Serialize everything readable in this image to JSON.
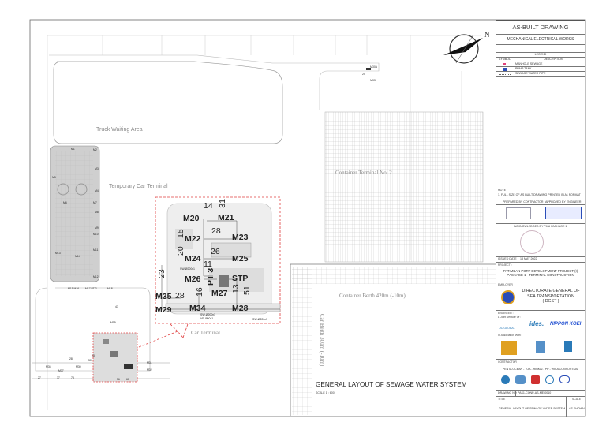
{
  "drawing": {
    "areas": {
      "truck_waiting": "Truck Waiting Area",
      "temp_car_terminal": "Temporary Car Terminal",
      "container_terminal": "Container Terminal No. 2",
      "car_terminal": "Car Terminal",
      "container_berth": "Container Berth 420m (-10m)",
      "car_berth": "Car Berth 300m (-10m)"
    },
    "title": "GENERAL LAYOUT  OF SEWAGE WATER SYSTEM",
    "scale": "SCALE 1 : 600",
    "north": "N",
    "top_labels": [
      "M30A",
      "M33",
      "25"
    ],
    "detail_labels": [
      "M20",
      "M21",
      "14",
      "31",
      "28",
      "15",
      "M22",
      "M23",
      "20",
      "26",
      "M24",
      "M25",
      "SW-Ø200x1",
      "23",
      "11",
      "M26",
      "PT 3",
      "STP",
      "16",
      "M27",
      "13",
      "51",
      "M35",
      "28",
      "M29",
      "M34",
      "M28",
      "SW-Ø200x1",
      "VP-Ø50x1",
      "SW-Ø200x1"
    ],
    "left_labels": [
      "M1",
      "M2",
      "M3",
      "M4",
      "M5",
      "M6",
      "M7",
      "M8",
      "M9",
      "M10",
      "M11",
      "M12",
      "M13",
      "M14",
      "M15  M16",
      "M17  PT 2",
      "M18",
      "M19",
      "M31",
      "M32",
      "M36",
      "M37",
      "M30",
      "27",
      "37",
      "73",
      "56",
      "60",
      "28",
      "50",
      "47",
      "23"
    ]
  },
  "title_block": {
    "header": "AS-BUILT DRAWING",
    "subheader": "MECHANICAL ELECTRICAL WORKS",
    "legend": {
      "title": "LEGEND",
      "col_symbol": "SYMBOL",
      "col_desc": "DESCRIPTION",
      "items": [
        "MANHOLE SEWAGE",
        "PUMP TANK",
        "SEWAGE WATER PIPE"
      ]
    },
    "note_title": "NOTE :",
    "note": "1. FULL SIZE OF AS BUILT DRAWING PRINTED IN A1 FORMAT",
    "prepared_by": "PREPARED BY CONTRACTOR",
    "approved_by": "APPROVED BY ENGINEER",
    "acknowledged_by": "ACKNOWLEDGED BY PMU PACKAGE 1",
    "issued_date_label": "ISSUED DATE",
    "issued_date": "13 MAY 2022",
    "project_label": "PROJECT :",
    "project": [
      "PATIMBAN PORT DEVELOPMENT PROJECT (I)",
      "PACKAGE 1 - TERMINAL CONSTRUCTION"
    ],
    "employer_label": "EMPLOYER :",
    "employer": [
      "DIRECTORATE GENERAL OF",
      "SEA TRANSPORTATION",
      "( DGST )"
    ],
    "engineer_label": "ENGINEER :",
    "engineer_jv": "A Joint Venture Of :",
    "engineer_firms": [
      "OC GLOBAL",
      "ides.",
      "NIPPON KOEI"
    ],
    "association": "In Association With :",
    "contractor_label": "CONTRACTOR :",
    "contractor": "PENTA OCEAN - TOA - RINKAI - PP - WIKA CONSORTIUM",
    "drawing_no_label": "DRAWING NO",
    "drawing_no": "PAS1-CONP-AS-ME-0010",
    "title_label": "TITLE",
    "scale_label": "SCALE",
    "title": "GENERAL LAYOUT  OF SEWAGE WATER SYSTEM",
    "scale": "AS SHOWN"
  },
  "colors": {
    "manhole": "#e0407a",
    "pump": "#2a4db8",
    "redline": "#e04040"
  }
}
